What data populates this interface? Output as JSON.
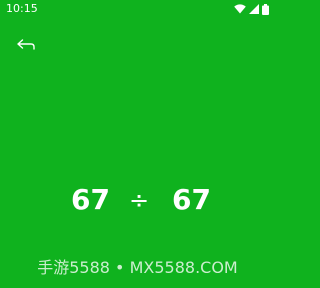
{
  "status_bar": {
    "time": "10:15",
    "icons": [
      "wifi-icon",
      "cellular-signal-icon",
      "battery-icon"
    ]
  },
  "header": {
    "back_icon": "back-arrow-icon"
  },
  "equation": {
    "left_operand": "67",
    "operator": "÷",
    "right_operand": "67"
  },
  "watermark": {
    "text": "手游5588 • MX5588.COM"
  },
  "colors": {
    "background": "#0fb21e",
    "foreground": "#ffffff"
  }
}
